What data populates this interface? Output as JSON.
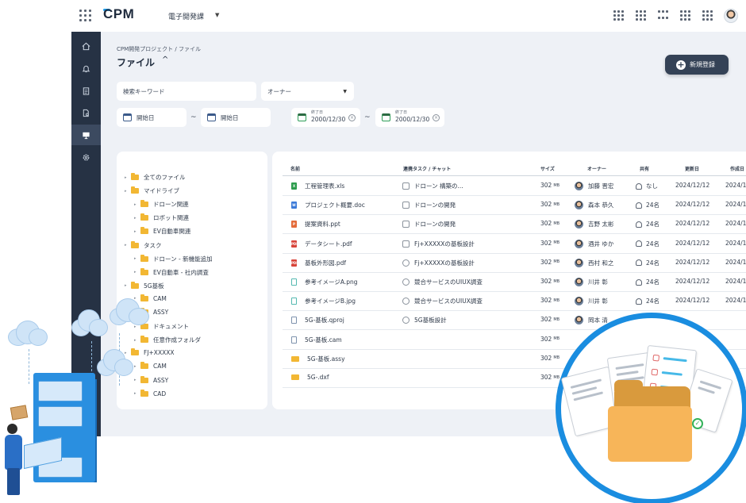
{
  "header": {
    "logo": "CPM",
    "project": "電子開発課"
  },
  "sidebar": {
    "items": [
      {
        "name": "home-icon"
      },
      {
        "name": "bell-icon"
      },
      {
        "name": "clipboard-icon"
      },
      {
        "name": "file-search-icon"
      },
      {
        "name": "monitor-icon",
        "active": true
      },
      {
        "name": "gear-icon"
      }
    ]
  },
  "page": {
    "breadcrumb": "CPM開発プロジェクト / ファイル",
    "title": "ファイル",
    "new_button": "新規登録"
  },
  "filters": {
    "keyword_placeholder": "検索キーワード",
    "owner_placeholder": "オーナー",
    "start_from": "開始日",
    "start_to": "開始日",
    "end_label": "終了日",
    "end_from": "2000/12/30",
    "end_to": "2000/12/30",
    "tilde": "~"
  },
  "tree": [
    {
      "label": "全てのファイル",
      "level": 0
    },
    {
      "label": "マイドライブ",
      "level": 0
    },
    {
      "label": "ドローン関連",
      "level": 1
    },
    {
      "label": "ロボット関連",
      "level": 1
    },
    {
      "label": "EV自動車関連",
      "level": 1
    },
    {
      "label": "タスク",
      "level": 0
    },
    {
      "label": "ドローン - 新機能追加",
      "level": 1
    },
    {
      "label": "EV自動車 - 社内調査",
      "level": 1
    },
    {
      "label": "5G基板",
      "level": 0
    },
    {
      "label": "CAM",
      "level": 1
    },
    {
      "label": "ASSY",
      "level": 1
    },
    {
      "label": "ドキュメント",
      "level": 1
    },
    {
      "label": "任意作成フォルダ",
      "level": 1
    },
    {
      "label": "FJ+XXXXX",
      "level": 0
    },
    {
      "label": "CAM",
      "level": 1
    },
    {
      "label": "ASSY",
      "level": 1
    },
    {
      "label": "CAD",
      "level": 1
    }
  ],
  "table": {
    "columns": [
      "名前",
      "連携タスク / チャット",
      "サイズ",
      "オーナー",
      "共有",
      "更新日",
      "作成日"
    ],
    "size_unit": "MB",
    "rows": [
      {
        "icon": "xls",
        "name": "工程管理表.xls",
        "task": "ドローン 構築の...",
        "task_type": "task",
        "size": "302",
        "owner": "加藤 晋宏",
        "share": "なし",
        "updated": "2024/12/12",
        "created": "2024/1"
      },
      {
        "icon": "doc",
        "name": "プロジェクト概要.doc",
        "task": "ドローンの開発",
        "task_type": "task",
        "size": "302",
        "owner": "森本 恭久",
        "share": "24名",
        "updated": "2024/12/12",
        "created": "2024/1"
      },
      {
        "icon": "ppt",
        "name": "提案資料.ppt",
        "task": "ドローンの開発",
        "task_type": "task",
        "size": "302",
        "owner": "吉野 太彬",
        "share": "24名",
        "updated": "2024/12/12",
        "created": "2024/1"
      },
      {
        "icon": "pdf",
        "name": "データシート.pdf",
        "task": "Fj+XXXXXの基板設計",
        "task_type": "task",
        "size": "302",
        "owner": "酒井 ゆか",
        "share": "24名",
        "updated": "2024/12/12",
        "created": "2024/1"
      },
      {
        "icon": "pdf",
        "name": "基板外形図.pdf",
        "task": "Fj+XXXXXの基板設計",
        "task_type": "chat",
        "size": "302",
        "owner": "西村 和之",
        "share": "24名",
        "updated": "2024/12/12",
        "created": "2024/1"
      },
      {
        "icon": "img",
        "name": "参考イメージA.png",
        "task": "競合サービスのUIUX調査",
        "task_type": "chat",
        "size": "302",
        "owner": "川井 彰",
        "share": "24名",
        "updated": "2024/12/12",
        "created": "2024/1"
      },
      {
        "icon": "img",
        "name": "参考イメージB.jpg",
        "task": "競合サービスのUIUX調査",
        "task_type": "chat",
        "size": "302",
        "owner": "川井 彰",
        "share": "24名",
        "updated": "2024/12/12",
        "created": "2024/1"
      },
      {
        "icon": "gen",
        "name": "5G-基板.qproj",
        "task": "5G基板設計",
        "task_type": "chat",
        "size": "302",
        "owner": "岡本 清",
        "share": "",
        "updated": "",
        "created": ""
      },
      {
        "icon": "gen",
        "name": "5G-基板.cam",
        "task": "",
        "task_type": "",
        "size": "302",
        "owner": "",
        "share": "",
        "updated": "",
        "created": ""
      },
      {
        "icon": "fold",
        "name": "5G-基板.assy",
        "task": "",
        "task_type": "",
        "size": "302",
        "owner": "",
        "share": "",
        "updated": "",
        "created": ""
      },
      {
        "icon": "fold",
        "name": "5G-.dxf",
        "task": "",
        "task_type": "",
        "size": "302",
        "owner": "",
        "share": "",
        "updated": "",
        "created": ""
      }
    ]
  },
  "colors": {
    "sidebar": "#263244",
    "accent": "#1a8de0",
    "button": "#344256"
  }
}
